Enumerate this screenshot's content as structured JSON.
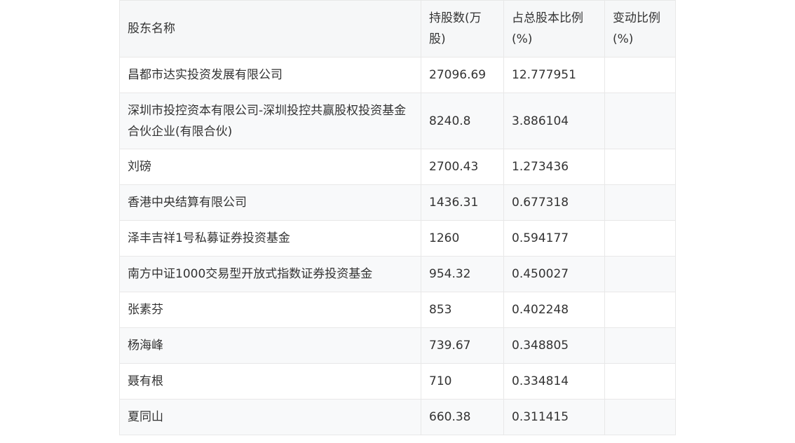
{
  "table": {
    "headers": [
      "股东名称",
      "持股数(万股)",
      "占总股本比例(%)",
      "变动比例(%)"
    ],
    "rows": [
      [
        "昌都市达实投资发展有限公司",
        "27096.69",
        "12.777951",
        ""
      ],
      [
        "深圳市投控资本有限公司-深圳投控共赢股权投资基金合伙企业(有限合伙)",
        "8240.8",
        "3.886104",
        ""
      ],
      [
        "刘磅",
        "2700.43",
        "1.273436",
        ""
      ],
      [
        "香港中央结算有限公司",
        "1436.31",
        "0.677318",
        ""
      ],
      [
        "泽丰吉祥1号私募证券投资基金",
        "1260",
        "0.594177",
        ""
      ],
      [
        "南方中证1000交易型开放式指数证券投资基金",
        "954.32",
        "0.450027",
        ""
      ],
      [
        "张素芬",
        "853",
        "0.402248",
        ""
      ],
      [
        "杨海峰",
        "739.67",
        "0.348805",
        ""
      ],
      [
        "聂有根",
        "710",
        "0.334814",
        ""
      ],
      [
        "夏同山",
        "660.38",
        "0.311415",
        ""
      ]
    ]
  }
}
